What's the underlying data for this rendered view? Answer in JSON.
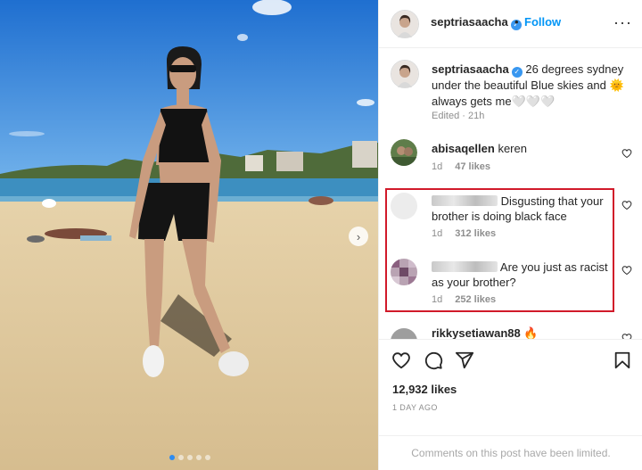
{
  "post": {
    "username": "septriasaacha",
    "separator": "•",
    "follow_label": "Follow",
    "more_icon": "more-horizontal-icon",
    "more_label": "···"
  },
  "caption": {
    "username": "septriasaacha",
    "text": "26 degrees sydney under the beautiful Blue skies and 🌞 always gets me🤍🤍🤍",
    "edited": "Edited",
    "time": "21h"
  },
  "comments": [
    {
      "username": "abisaqellen",
      "text": "keren",
      "time": "1d",
      "likes": "47 likes"
    },
    {
      "username": "",
      "text": "Disgusting that your brother is doing black face",
      "time": "1d",
      "likes": "312 likes"
    },
    {
      "username": "",
      "text": "Are you just as racist as your brother?",
      "time": "1d",
      "likes": "252 likes"
    },
    {
      "username": "rikkysetiawan88",
      "text": ""
    }
  ],
  "actions": {
    "like_icon": "heart-icon",
    "comment_icon": "comment-icon",
    "share_icon": "paper-plane-icon",
    "save_icon": "bookmark-icon"
  },
  "likes_count": "12,932 likes",
  "date": "1 DAY AGO",
  "comments_limited": "Comments on this post have been limited.",
  "colors": {
    "accent": "#0095f6",
    "highlight": "#d11a2a",
    "verified": "#3897f0"
  }
}
